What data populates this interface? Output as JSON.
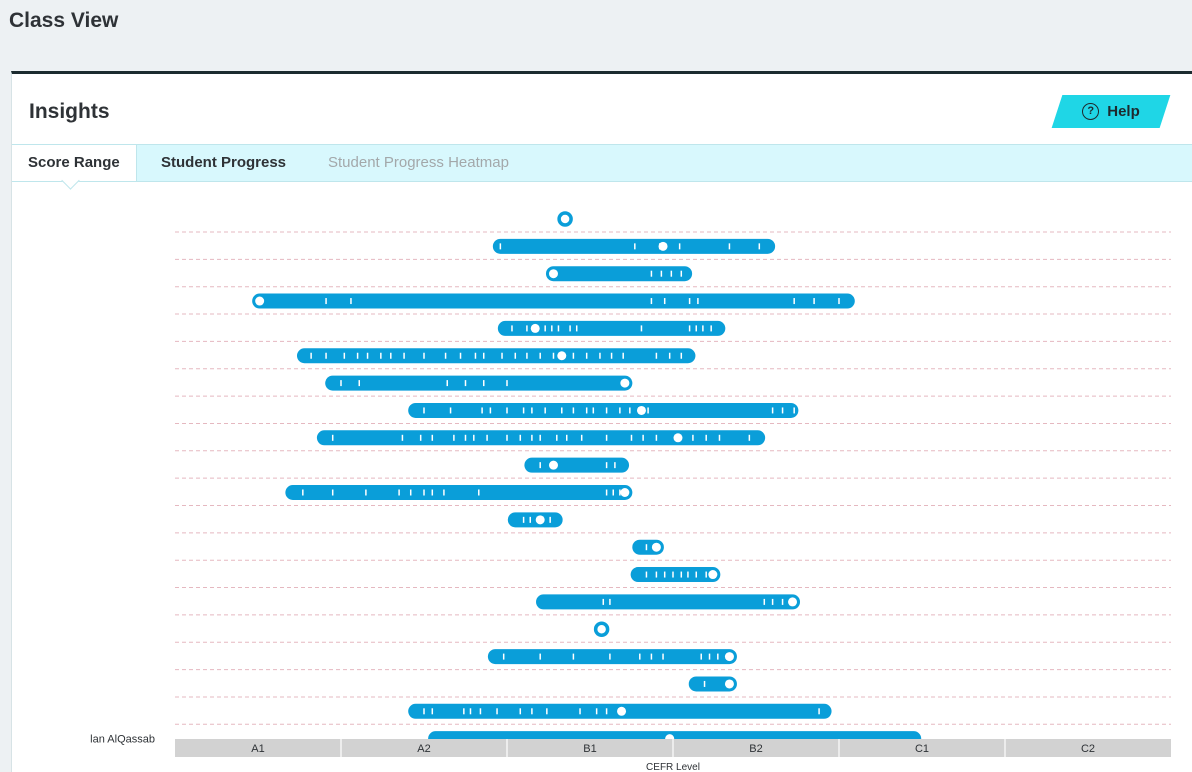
{
  "page": {
    "title": "Class View"
  },
  "panel": {
    "title": "Insights",
    "help_label": "Help"
  },
  "tabs": [
    {
      "label": "Score Range",
      "state": "active"
    },
    {
      "label": "Student Progress",
      "state": "normal"
    },
    {
      "label": "Student Progress Heatmap",
      "state": "disabled"
    }
  ],
  "colors": {
    "bar": "#0a9ed9",
    "tick": "#ffffff",
    "gridline": "#e5b8c0",
    "accent": "#1fd6e6",
    "axis_band": "#d2d2d2"
  },
  "chart_data": {
    "type": "range-strip",
    "xlabel": "CEFR Level",
    "x_categories": [
      "A1",
      "A2",
      "B1",
      "B2",
      "C1",
      "C2"
    ],
    "xlim": [
      0,
      6
    ],
    "grid": true,
    "rows": [
      {
        "name": "",
        "min": 2.35,
        "max": 2.35,
        "current": 2.35,
        "ticks": []
      },
      {
        "name": "",
        "min": 1.96,
        "max": 3.57,
        "current": 2.94,
        "ticks": [
          1.96,
          2.77,
          2.92,
          3.04,
          3.34,
          3.52
        ]
      },
      {
        "name": "",
        "min": 2.28,
        "max": 3.07,
        "current": 2.28,
        "ticks": [
          2.87,
          2.93,
          2.99,
          3.05
        ]
      },
      {
        "name": "",
        "min": 0.51,
        "max": 4.05,
        "current": 0.51,
        "ticks": [
          0.91,
          1.06,
          2.87,
          2.95,
          3.1,
          3.15,
          3.73,
          3.85,
          4.0
        ]
      },
      {
        "name": "",
        "min": 1.99,
        "max": 3.27,
        "current": 2.17,
        "ticks": [
          2.03,
          2.12,
          2.23,
          2.27,
          2.31,
          2.38,
          2.42,
          2.81,
          3.1,
          3.14,
          3.18,
          3.23
        ]
      },
      {
        "name": "",
        "min": 0.78,
        "max": 3.09,
        "current": 2.33,
        "ticks": [
          0.82,
          0.91,
          1.02,
          1.1,
          1.16,
          1.24,
          1.3,
          1.38,
          1.5,
          1.63,
          1.72,
          1.81,
          1.86,
          1.97,
          2.05,
          2.12,
          2.2,
          2.28,
          2.4,
          2.48,
          2.56,
          2.63,
          2.7,
          2.9,
          2.98,
          3.05
        ]
      },
      {
        "name": "",
        "min": 0.95,
        "max": 2.71,
        "current": 2.71,
        "ticks": [
          1.0,
          1.11,
          1.64,
          1.75,
          1.86,
          2.0
        ]
      },
      {
        "name": "",
        "min": 1.45,
        "max": 3.71,
        "current": 2.81,
        "ticks": [
          1.5,
          1.66,
          1.85,
          1.9,
          2.0,
          2.1,
          2.15,
          2.23,
          2.33,
          2.4,
          2.48,
          2.52,
          2.6,
          2.68,
          2.74,
          2.85,
          3.6,
          3.66,
          3.73
        ]
      },
      {
        "name": "",
        "min": 0.9,
        "max": 3.51,
        "current": 3.03,
        "ticks": [
          0.95,
          1.37,
          1.48,
          1.55,
          1.68,
          1.75,
          1.8,
          1.88,
          2.0,
          2.08,
          2.15,
          2.2,
          2.3,
          2.36,
          2.45,
          2.6,
          2.75,
          2.82,
          2.9,
          3.12,
          3.2,
          3.28,
          3.46
        ]
      },
      {
        "name": "",
        "min": 2.15,
        "max": 2.69,
        "current": 2.28,
        "ticks": [
          2.2,
          2.27,
          2.6,
          2.65
        ]
      },
      {
        "name": "",
        "min": 0.71,
        "max": 2.71,
        "current": 2.71,
        "ticks": [
          0.77,
          0.95,
          1.15,
          1.35,
          1.42,
          1.5,
          1.55,
          1.62,
          1.83,
          2.6,
          2.64,
          2.68
        ]
      },
      {
        "name": "",
        "min": 2.05,
        "max": 2.29,
        "current": 2.2,
        "ticks": [
          2.1,
          2.14,
          2.26
        ]
      },
      {
        "name": "",
        "min": 2.8,
        "max": 2.9,
        "current": 2.9,
        "ticks": [
          2.84
        ]
      },
      {
        "name": "",
        "min": 2.79,
        "max": 3.24,
        "current": 3.24,
        "ticks": [
          2.84,
          2.9,
          2.95,
          3.0,
          3.05,
          3.09,
          3.14,
          3.2
        ]
      },
      {
        "name": "",
        "min": 2.22,
        "max": 3.72,
        "current": 3.72,
        "ticks": [
          2.58,
          2.62,
          3.55,
          3.6,
          3.66
        ]
      },
      {
        "name": "",
        "min": 2.57,
        "max": 2.57,
        "current": 2.57,
        "ticks": []
      },
      {
        "name": "",
        "min": 1.93,
        "max": 3.34,
        "current": 3.34,
        "ticks": [
          1.98,
          2.2,
          2.4,
          2.62,
          2.8,
          2.87,
          2.94,
          3.17,
          3.22,
          3.27
        ]
      },
      {
        "name": "",
        "min": 3.14,
        "max": 3.34,
        "current": 3.34,
        "ticks": [
          3.19
        ]
      },
      {
        "name": "",
        "min": 1.45,
        "max": 3.91,
        "current": 2.69,
        "ticks": [
          1.5,
          1.55,
          1.74,
          1.78,
          1.84,
          1.94,
          2.08,
          2.15,
          2.24,
          2.44,
          2.54,
          2.6,
          3.88
        ]
      },
      {
        "name": "lan AlQassab",
        "min": 1.57,
        "max": 4.45,
        "current": 2.98,
        "ticks": []
      }
    ]
  }
}
